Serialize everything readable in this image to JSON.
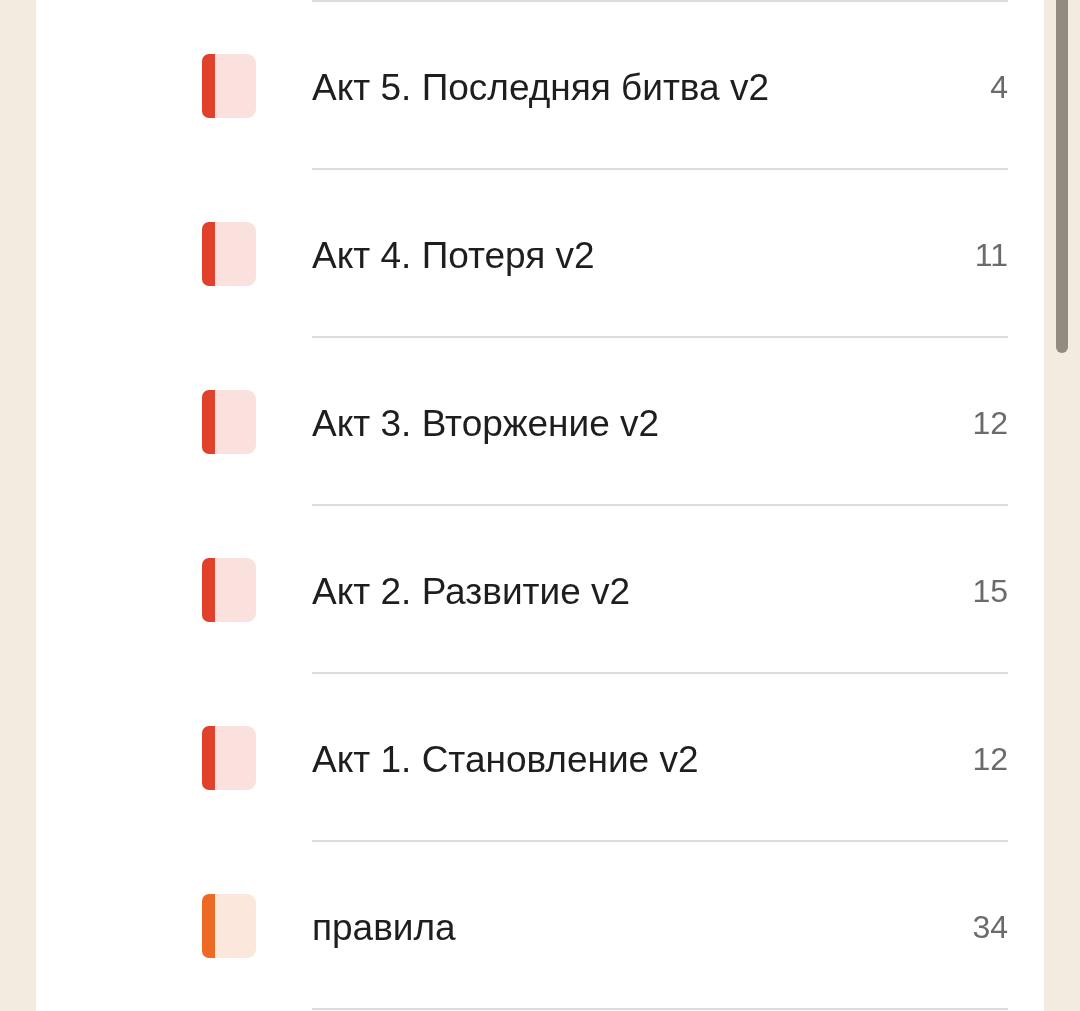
{
  "folders": [
    {
      "name": "Акт 5. Последняя битва v2",
      "count": "4",
      "color": "#e0412a"
    },
    {
      "name": "Акт 4. Потеря v2",
      "count": "11",
      "color": "#e0412a"
    },
    {
      "name": "Акт 3. Вторжение v2",
      "count": "12",
      "color": "#e0412a"
    },
    {
      "name": "Акт 2. Развитие v2",
      "count": "15",
      "color": "#e0412a"
    },
    {
      "name": "Акт 1. Становление v2",
      "count": "12",
      "color": "#e0412a"
    },
    {
      "name": "правила",
      "count": "34",
      "color": "#ec6a24"
    }
  ]
}
